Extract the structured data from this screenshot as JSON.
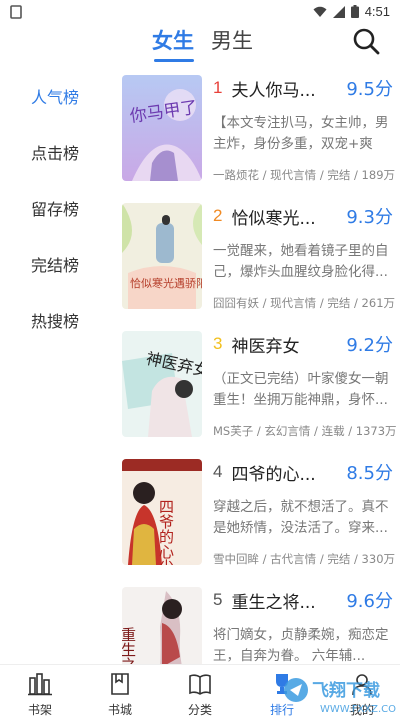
{
  "status": {
    "time": "4:51"
  },
  "tabs": {
    "female": "女生",
    "male": "男生"
  },
  "sidebar": {
    "items": [
      {
        "label": "人气榜",
        "active": true
      },
      {
        "label": "点击榜",
        "active": false
      },
      {
        "label": "留存榜",
        "active": false
      },
      {
        "label": "完结榜",
        "active": false
      },
      {
        "label": "热搜榜",
        "active": false
      }
    ]
  },
  "books": [
    {
      "rank": "1",
      "title": "夫人你马...",
      "score": "9.5分",
      "desc": "【本文专注扒马，女主帅，男主炸，身份多重，双宠+爽文...",
      "meta": "一路烦花 / 现代言情 / 完结 / 189万",
      "cover_title": "你马甲了",
      "rank_color": "#e8413a"
    },
    {
      "rank": "2",
      "title": "恰似寒光...",
      "score": "9.3分",
      "desc": "一觉醒来，她看着镜子里的自己，爆炸头血腥纹身脸化得...",
      "meta": "囧囧有妖 / 现代言情 / 完结 / 261万",
      "cover_title": "恰似寒光遇骄阳",
      "rank_color": "#f08a24"
    },
    {
      "rank": "3",
      "title": "神医弃女",
      "score": "9.2分",
      "desc": "（正文已完结）叶家傻女一朝重生！坐拥万能神鼎，身怀...",
      "meta": "MS芙子 / 玄幻言情 / 连载 / 1373万",
      "cover_title": "神医弃女",
      "rank_color": "#f2c01e"
    },
    {
      "rank": "4",
      "title": "四爷的心...",
      "score": "8.5分",
      "desc": "穿越之后，就不想活了。真不是她矫情，没法活了。穿来...",
      "meta": "雪中回眸 / 古代言情 / 完结 / 330万",
      "cover_title": "四爷的心尖宠妃",
      "rank_color": "#555555"
    },
    {
      "rank": "5",
      "title": "重生之将...",
      "score": "9.6分",
      "desc": "将门嫡女，贞静柔婉，痴恋定王，自奔为眷。 六年辅...",
      "meta": "",
      "cover_title": "重生之将门毒后",
      "rank_color": "#555555"
    }
  ],
  "bottom_nav": [
    {
      "label": "书架",
      "icon": "bookshelf-icon"
    },
    {
      "label": "书城",
      "icon": "bookstore-icon"
    },
    {
      "label": "分类",
      "icon": "category-icon"
    },
    {
      "label": "排行",
      "icon": "ranking-icon"
    },
    {
      "label": "我的",
      "icon": "profile-icon"
    }
  ],
  "watermark": {
    "text": "飞翔下载",
    "sub": "WWW.FXXZ.COM"
  }
}
